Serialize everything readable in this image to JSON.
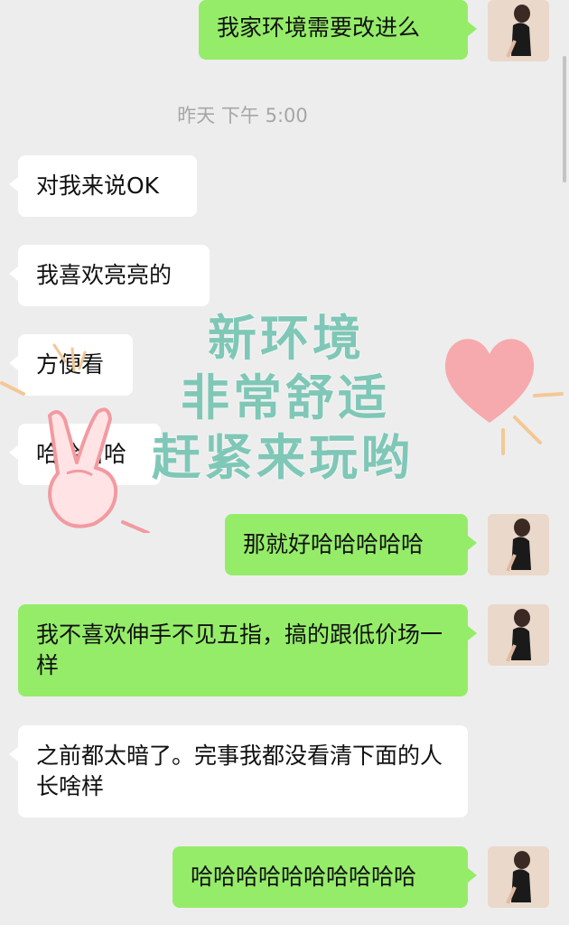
{
  "colors": {
    "background": "#ededed",
    "incoming_bubble": "#ffffff",
    "outgoing_bubble": "#95ec69",
    "sticker_text": "#7fc7b7",
    "heart": "#f6a2a5"
  },
  "timestamp": "昨天 下午 5:00",
  "messages": [
    {
      "side": "out",
      "text": "我家环境需要改进么"
    },
    {
      "side": "in",
      "text": "对我来说OK"
    },
    {
      "side": "in",
      "text": "我喜欢亮亮的"
    },
    {
      "side": "in",
      "text": "方便看"
    },
    {
      "side": "in",
      "text": "哈哈哈哈"
    },
    {
      "side": "out",
      "text": "那就好哈哈哈哈哈"
    },
    {
      "side": "out",
      "text": "我不喜欢伸手不见五指，搞的跟低价场一样"
    },
    {
      "side": "in",
      "text": "之前都太暗了。完事我都没看清下面的人长啥样"
    },
    {
      "side": "out",
      "text": "哈哈哈哈哈哈哈哈哈哈"
    }
  ],
  "sticker": {
    "line1": "新环境",
    "line2": "非常舒适",
    "line3": "赶紧来玩哟"
  },
  "icons": {
    "avatar": "user-avatar-photo",
    "heart": "heart-sticker-icon",
    "hand": "peace-hand-sticker-icon"
  }
}
